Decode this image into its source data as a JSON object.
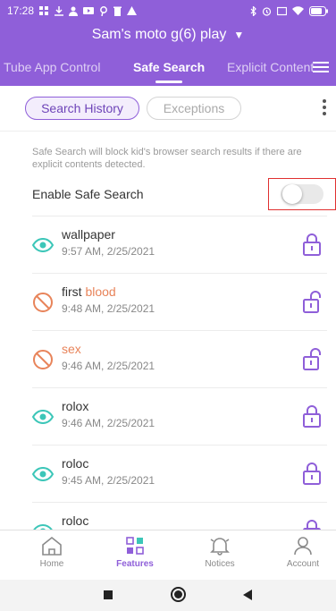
{
  "status_bar": {
    "time": "17:28",
    "battery": "73"
  },
  "device": {
    "name": "Sam's moto g(6) play"
  },
  "tabs": [
    {
      "label": "Tube App Control"
    },
    {
      "label": "Safe Search"
    },
    {
      "label": "Explicit Content"
    }
  ],
  "subtabs": {
    "history": "Search History",
    "exceptions": "Exceptions"
  },
  "safe_search": {
    "description": "Safe Search will block kid's browser search results if there are explicit contents detected.",
    "enable_label": "Enable Safe Search",
    "enabled": false
  },
  "history": [
    {
      "term": "wallpaper",
      "time": "9:57 AM, 2/25/2021",
      "status": "allowed",
      "lock": "locked"
    },
    {
      "term_prefix": "first ",
      "term_highlight": "blood",
      "time": "9:48 AM, 2/25/2021",
      "status": "blocked",
      "lock": "unlocked"
    },
    {
      "term": "sex",
      "time": "9:46 AM, 2/25/2021",
      "status": "blocked",
      "lock": "unlocked"
    },
    {
      "term": "rolox",
      "time": "9:46 AM, 2/25/2021",
      "status": "allowed",
      "lock": "locked"
    },
    {
      "term": "roloc",
      "time": "9:45 AM, 2/25/2021",
      "status": "allowed",
      "lock": "locked"
    },
    {
      "term": "roloc",
      "time": "",
      "status": "allowed",
      "lock": "locked"
    }
  ],
  "bottom_nav": {
    "home": "Home",
    "features": "Features",
    "notices": "Notices",
    "account": "Account"
  },
  "colors": {
    "brand": "#8f5fd9",
    "allowed": "#3cc6b8",
    "blocked": "#e8845a"
  }
}
